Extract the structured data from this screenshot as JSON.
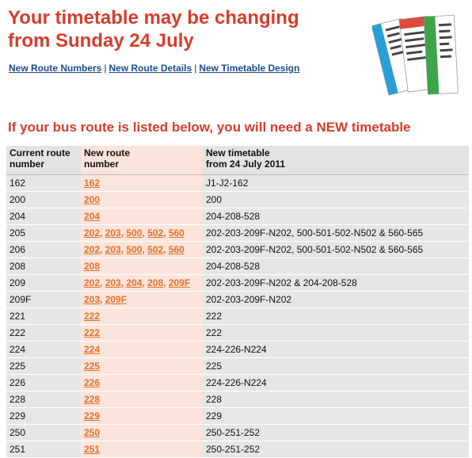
{
  "header": {
    "title_line1": "Your timetable may be changing",
    "title_line2": "from Sunday 24 July"
  },
  "links": [
    "New Route Numbers",
    "New Route Details",
    "New Timetable Design"
  ],
  "link_separator": "|",
  "subheading": "If your bus route is listed below, you will need a NEW timetable",
  "table": {
    "headers": {
      "current": [
        "Current route",
        "number"
      ],
      "new_route": [
        "New route",
        "number"
      ],
      "new_timetable": [
        "New timetable",
        "from 24 July 2011"
      ]
    },
    "rows": [
      {
        "current": "162",
        "routes": [
          "162"
        ],
        "timetable": "J1-J2-162"
      },
      {
        "current": "200",
        "routes": [
          "200"
        ],
        "timetable": "200"
      },
      {
        "current": "204",
        "routes": [
          "204"
        ],
        "timetable": "204-208-528"
      },
      {
        "current": "205",
        "routes": [
          "202",
          "203",
          "500",
          "502",
          "560"
        ],
        "timetable": "202-203-209F-N202, 500-501-502-N502 & 560-565"
      },
      {
        "current": "206",
        "routes": [
          "202",
          "203",
          "500",
          "502",
          "560"
        ],
        "timetable": "202-203-209F-N202, 500-501-502-N502 & 560-565"
      },
      {
        "current": "208",
        "routes": [
          "208"
        ],
        "timetable": "204-208-528"
      },
      {
        "current": "209",
        "routes": [
          "202",
          "203",
          "204",
          "208",
          "209F"
        ],
        "timetable": "202-203-209F-N202 & 204-208-528"
      },
      {
        "current": "209F",
        "routes": [
          "203",
          "209F"
        ],
        "timetable": "202-203-209F-N202"
      },
      {
        "current": "221",
        "routes": [
          "222"
        ],
        "timetable": "222"
      },
      {
        "current": "222",
        "routes": [
          "222"
        ],
        "timetable": "222"
      },
      {
        "current": "224",
        "routes": [
          "224"
        ],
        "timetable": "224-226-N224"
      },
      {
        "current": "225",
        "routes": [
          "225"
        ],
        "timetable": "225"
      },
      {
        "current": "226",
        "routes": [
          "226"
        ],
        "timetable": "224-226-N224"
      },
      {
        "current": "228",
        "routes": [
          "228"
        ],
        "timetable": "228"
      },
      {
        "current": "229",
        "routes": [
          "229"
        ],
        "timetable": "229"
      },
      {
        "current": "250",
        "routes": [
          "250"
        ],
        "timetable": "250-251-252"
      },
      {
        "current": "251",
        "routes": [
          "251"
        ],
        "timetable": "250-251-252"
      }
    ]
  },
  "colors": {
    "headline": "#d53d2b",
    "link": "#1c4b8c",
    "route_link": "#e2712b",
    "row_bg": "#e6e6e6",
    "route_col_bg": "#fbe4dc"
  },
  "icons": {
    "timetable_leaflets": "timetable-leaflets-image"
  }
}
